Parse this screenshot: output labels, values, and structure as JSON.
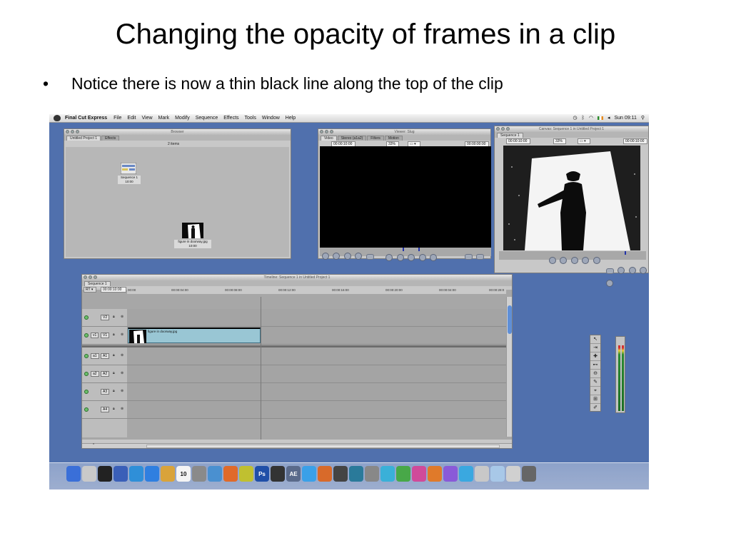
{
  "slide": {
    "title": "Changing the opacity of frames in a clip",
    "bullet": "Notice there is now a thin black line along the top of the clip"
  },
  "menubar": {
    "app_name": "Final Cut Express",
    "items": [
      "File",
      "Edit",
      "View",
      "Mark",
      "Modify",
      "Sequence",
      "Effects",
      "Tools",
      "Window",
      "Help"
    ],
    "clock": "Sun 09:11"
  },
  "browser": {
    "title": "Browser",
    "tabs": [
      "Untitled Project 1",
      "Effects"
    ],
    "item_count": "2 items",
    "items": [
      {
        "name": "Sequence 1",
        "duration": "10:00"
      },
      {
        "name": "figure in doorway.jpg",
        "duration": "10:00"
      }
    ]
  },
  "viewer": {
    "title": "Viewer: Slug",
    "tabs": [
      "Video",
      "Stereo (a1a2)",
      "Filters",
      "Motion"
    ],
    "timecode_left": "00:00:10:00",
    "zoom": "33%",
    "timecode_right": "00:00:00:00"
  },
  "canvas": {
    "title": "Canvas: Sequence 1 in Untitled Project 1",
    "tab": "Sequence 1",
    "timecode_left": "00:00:10:00",
    "zoom": "33%",
    "timecode_right": "00:00:10:00"
  },
  "timeline": {
    "title": "Timeline: Sequence 1 in Untitled Project 1",
    "tab": "Sequence 1",
    "rt_label": "RT",
    "current_timecode": "00:00:10:00",
    "ruler": [
      "00:00",
      "00:00:04:00",
      "00:00:08:00",
      "00:00:12:00",
      "00:00:16:00",
      "00:00:20:00",
      "00:00:04:00",
      "00:00:28:0"
    ],
    "video_tracks": [
      {
        "src": "",
        "dest": "V2"
      },
      {
        "src": "v1",
        "dest": "V1"
      }
    ],
    "audio_tracks": [
      {
        "src": "a1",
        "dest": "A1"
      },
      {
        "src": "a2",
        "dest": "A2"
      },
      {
        "src": "",
        "dest": "A3"
      },
      {
        "src": "",
        "dest": "A4"
      }
    ],
    "clip_name": "figure in doorway.jpg"
  },
  "tool_palette": [
    "↖",
    "⇥",
    "✚",
    "⊷",
    "⊖",
    "✎",
    "⌖",
    "⊞",
    "✐"
  ],
  "dock": {
    "items": [
      "",
      "",
      "",
      "",
      "",
      "",
      "",
      "10",
      "",
      "",
      "",
      "",
      "Ps",
      "",
      "AE",
      "",
      "",
      "",
      "",
      "",
      "",
      "",
      "",
      "",
      "",
      "",
      "",
      "",
      "",
      ""
    ]
  }
}
